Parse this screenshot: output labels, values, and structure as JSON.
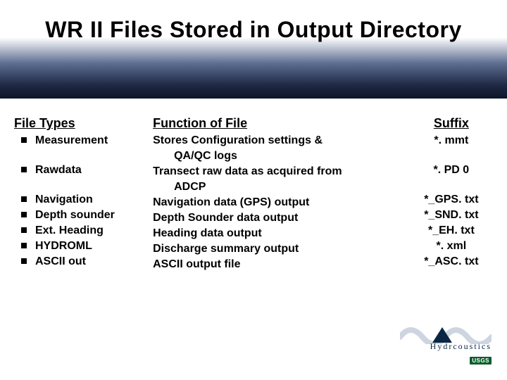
{
  "title": "WR II Files Stored in Output Directory",
  "headers": {
    "types": "File Types",
    "func": "Function of File",
    "suffix": "Suffix"
  },
  "rows": {
    "r1": {
      "type": "Measurement",
      "func1": "Stores Configuration settings &",
      "func2": "QA/QC logs",
      "suffix": "*. mmt"
    },
    "r2": {
      "type": "Rawdata",
      "func1": "Transect raw data as acquired from",
      "func2": "ADCP",
      "suffix": "*. PD 0"
    },
    "r3": {
      "type": "Navigation",
      "func": "Navigation data (GPS) output",
      "suffix": "*_GPS. txt"
    },
    "r4": {
      "type": "Depth sounder",
      "func": "Depth Sounder data output",
      "suffix": "*_SND. txt"
    },
    "r5": {
      "type": "Ext. Heading",
      "func": "Heading data output",
      "suffix": "*_EH. txt"
    },
    "r6": {
      "type": "HYDROML",
      "func": "Discharge summary output",
      "suffix": "*. xml"
    },
    "r7": {
      "type": "ASCII out",
      "func": "ASCII output file",
      "suffix": "*_ASC. txt"
    }
  },
  "logo": {
    "brand_left": "Hydr",
    "brand_right": "coustics",
    "usgs": "USGS"
  }
}
